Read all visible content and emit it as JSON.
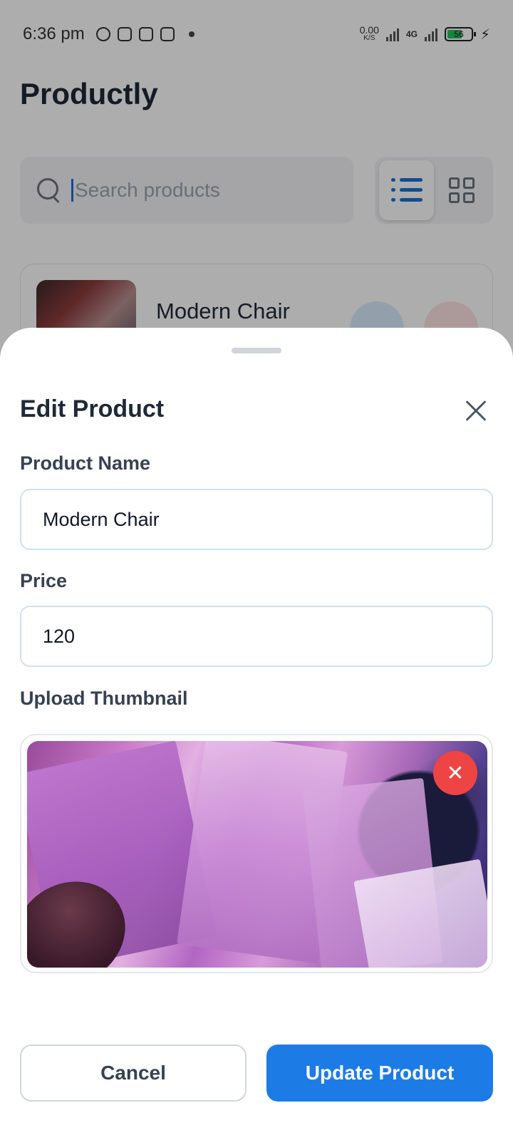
{
  "status_bar": {
    "time": "6:36 pm",
    "net_speed_value": "0.00",
    "net_speed_unit": "K/S",
    "network_type": "4G",
    "battery_level": "56"
  },
  "app": {
    "title": "Productly",
    "search_placeholder": "Search products"
  },
  "product_list": {
    "items": [
      {
        "name": "Modern Chair"
      }
    ]
  },
  "edit_sheet": {
    "title": "Edit Product",
    "name_label": "Product Name",
    "name_value": "Modern Chair",
    "price_label": "Price",
    "price_value": "120",
    "thumbnail_label": "Upload Thumbnail",
    "remove_icon": "close-icon",
    "cancel_label": "Cancel",
    "update_label": "Update Product"
  },
  "colors": {
    "primary": "#1d7be6",
    "danger": "#ef4444",
    "battery": "#22c55e"
  }
}
